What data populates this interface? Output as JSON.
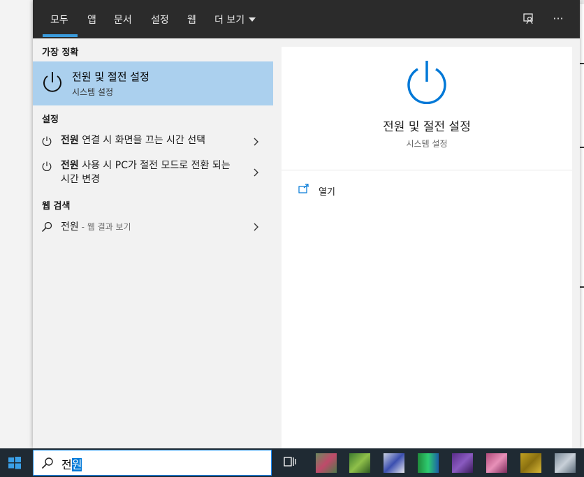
{
  "tabs": [
    {
      "label": "모두",
      "active": true
    },
    {
      "label": "앱"
    },
    {
      "label": "문서"
    },
    {
      "label": "설정"
    },
    {
      "label": "웹"
    },
    {
      "label": "더 보기"
    }
  ],
  "top_icons": [
    "feedback-icon",
    "more-options-icon"
  ],
  "more_glyph": "···",
  "best_match": {
    "heading": "가장 정확",
    "title": "전원 및 절전 설정",
    "subtitle": "시스템 설정"
  },
  "settings": {
    "heading": "설정",
    "items": [
      {
        "bold": "전원",
        "rest": " 연결 시 화면을 끄는 시간 선택"
      },
      {
        "bold": "전원",
        "rest": " 사용 시 PC가 절전 모드로 전환 되는 시간 변경"
      }
    ]
  },
  "web_search": {
    "heading": "웹 검색",
    "query": "전원",
    "suffix": " - 웹 결과 보기"
  },
  "preview": {
    "title": "전원 및 절전 설정",
    "subtitle": "시스템 설정",
    "open_label": "열기"
  },
  "search_box": {
    "text_plain": "전",
    "text_selected": "원"
  },
  "colors": {
    "accent": "#0078d7",
    "selected_row": "#abd0ee",
    "topbar": "#2b2b2b",
    "taskbar": "#1f2a33"
  }
}
